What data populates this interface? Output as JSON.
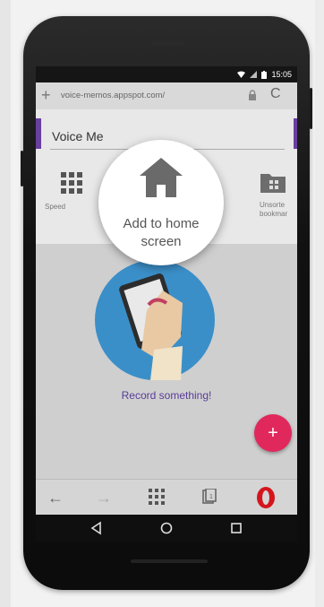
{
  "status": {
    "time": "15:05",
    "icons": [
      "wifi-icon",
      "signal-icon",
      "battery-icon"
    ]
  },
  "browser": {
    "url": "voice-memos.appspot.com/",
    "plus_icon": "+",
    "reload_icon": "C"
  },
  "speed_dial": {
    "title": "Voice Me",
    "left_tile_label": "Speed",
    "right_tile_label_line1": "Unsorte",
    "right_tile_label_line2": "bookmar"
  },
  "popup": {
    "label_line1": "Add to home",
    "label_line2": "screen"
  },
  "page": {
    "record_text": "Record something!",
    "fab_label": "+"
  },
  "colors": {
    "accent": "#6a3fa0",
    "fab": "#e0285c",
    "opera": "#d4151d"
  }
}
